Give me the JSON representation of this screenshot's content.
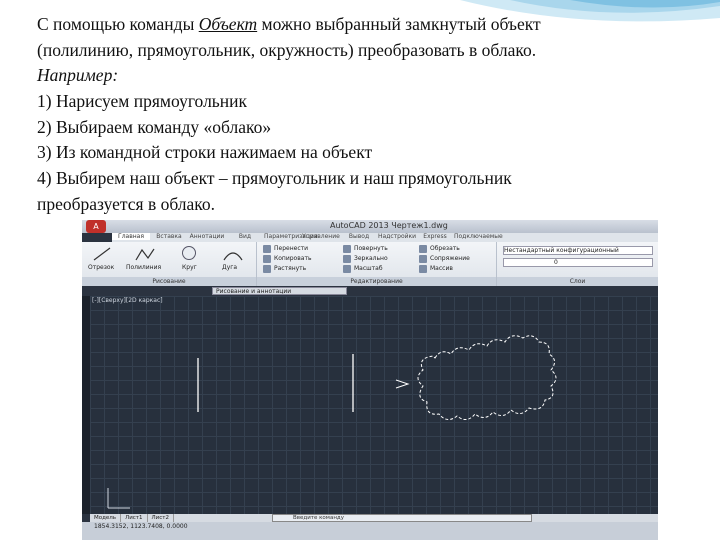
{
  "slide": {
    "line1_prefix": "С помощью команды ",
    "line1_command": "Объект",
    "line1_suffix": " можно выбранный замкнутый объект",
    "line2": "(полилинию, прямоугольник, окружность) преобразовать в облако.",
    "example_label": "Например:",
    "steps": [
      "1) Нарисуем прямоугольник",
      "2) Выбираем команду «облако»",
      "3) Из командной строки нажимаем на объект",
      "4) Выбирем наш объект – прямоугольник и наш прямоугольник"
    ],
    "line_last": "преобразуется в облако."
  },
  "screenshot": {
    "title": "AutoCAD 2013   Чертеж1.dwg",
    "app_button": "A",
    "tabs": [
      "Главная",
      "Вставка",
      "Аннотации",
      "Вид",
      "Параметризация",
      "Управление",
      "Вывод",
      "Надстройки",
      "Express",
      "Подключаемые"
    ],
    "ribbon": {
      "draw_tools": [
        "Отрезок",
        "Полилиния",
        "Круг",
        "Дуга"
      ],
      "draw_panel": "Рисование",
      "modify_items": [
        "Перенести",
        "Повернуть",
        "Обрезать",
        "Копировать",
        "Зеркально",
        "Сопряжение",
        "Растянуть",
        "Масштаб",
        "Массив"
      ],
      "modify_panel": "Редактирование",
      "layer_value": "0",
      "layer_props": "Нестандартный конфигурационный",
      "layers_panel": "Слои"
    },
    "workspace": "Рисование и аннотации",
    "viewport_label": "[-][Сверху][2D каркас]",
    "layout_tabs": [
      "Модель",
      "Лист1",
      "Лист2"
    ],
    "command_prompt": "Введите команду",
    "status_text": "1854.3152, 1123.7408, 0.0000",
    "colors": {
      "canvas": "#27303d",
      "grid": "#34404f",
      "ribbon": "#e9edf2",
      "lines": "#ffffff"
    }
  }
}
